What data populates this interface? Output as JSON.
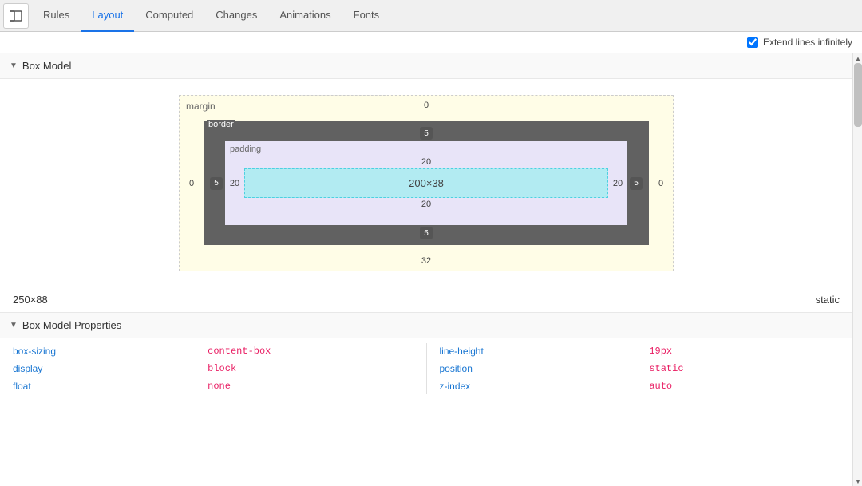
{
  "tabs": [
    {
      "id": "rules",
      "label": "Rules",
      "active": false
    },
    {
      "id": "layout",
      "label": "Layout",
      "active": true
    },
    {
      "id": "computed",
      "label": "Computed",
      "active": false
    },
    {
      "id": "changes",
      "label": "Changes",
      "active": false
    },
    {
      "id": "animations",
      "label": "Animations",
      "active": false
    },
    {
      "id": "fonts",
      "label": "Fonts",
      "active": false
    }
  ],
  "subbar": {
    "checkbox_label": "Extend lines infinitely",
    "checked": true
  },
  "box_model_section": {
    "title": "Box Model",
    "margin_label": "margin",
    "border_label": "border",
    "padding_label": "padding",
    "margin_top": "0",
    "margin_bottom": "32",
    "margin_left": "0",
    "margin_right": "0",
    "border_top": "5",
    "border_bottom": "5",
    "border_left": "5",
    "border_right": "5",
    "padding_top": "20",
    "padding_bottom": "20",
    "padding_left": "20",
    "padding_right": "20",
    "content_width": "200",
    "content_height": "38",
    "content_size": "200×38",
    "element_width": "250",
    "element_height": "88",
    "element_size": "250×88",
    "position": "static"
  },
  "box_model_properties": {
    "title": "Box Model Properties",
    "left_col": [
      {
        "key": "box-sizing",
        "value": "content-box"
      },
      {
        "key": "display",
        "value": "block"
      },
      {
        "key": "float",
        "value": "none"
      }
    ],
    "right_col": [
      {
        "key": "line-height",
        "value": "19px"
      },
      {
        "key": "position",
        "value": "static"
      },
      {
        "key": "z-index",
        "value": "auto"
      }
    ]
  }
}
